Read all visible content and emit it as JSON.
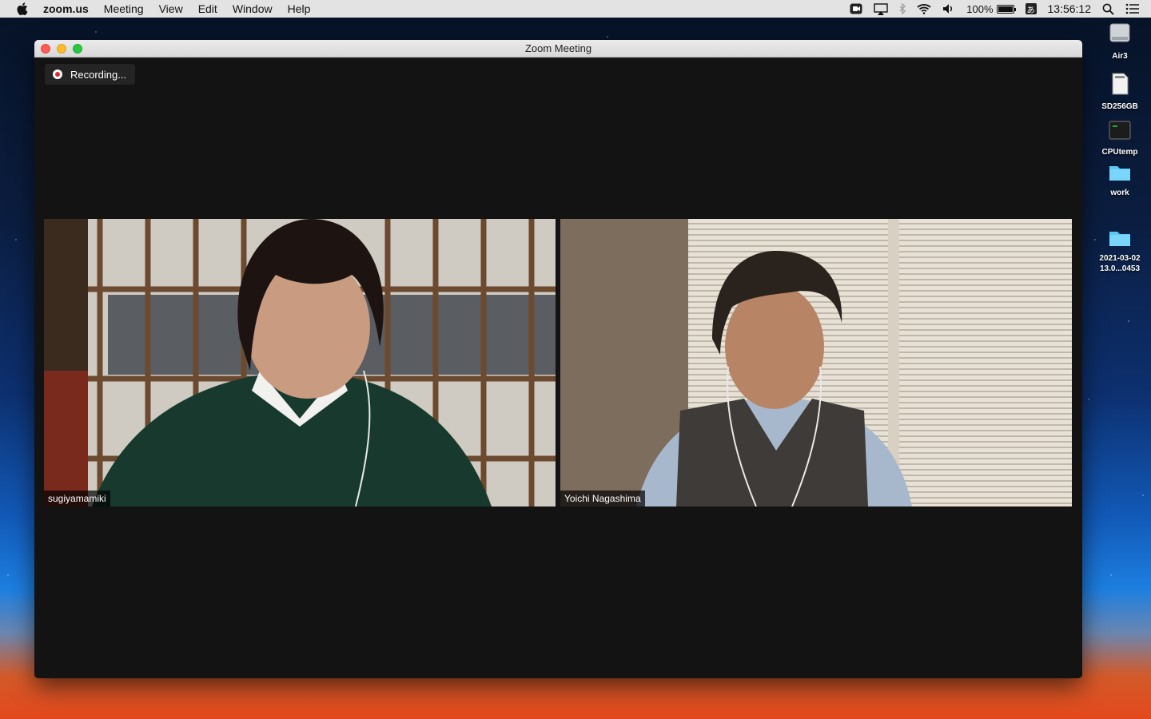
{
  "menubar": {
    "app_name": "zoom.us",
    "items": [
      "Meeting",
      "View",
      "Edit",
      "Window",
      "Help"
    ],
    "battery": "100%",
    "time": "13:56:12",
    "ime": "あ"
  },
  "desktop": {
    "icons": [
      {
        "label": "Air3",
        "icon": "hard-drive-icon"
      },
      {
        "label": "SD256GB",
        "icon": "sd-card-icon"
      },
      {
        "label": "CPUtemp",
        "icon": "terminal-icon"
      },
      {
        "label": "work",
        "icon": "folder-icon"
      },
      {
        "label_line1": "2021-03-02",
        "label_line2": "13.0...0453",
        "icon": "folder-icon"
      }
    ]
  },
  "window": {
    "title": "Zoom Meeting",
    "recording_label": "Recording...",
    "participants": [
      {
        "name": "sugiyamamiki"
      },
      {
        "name": "Yoichi Nagashima"
      }
    ]
  },
  "colors": {
    "window_bg": "#131313",
    "recording_dot": "#e02828",
    "folder": "#5ec8f5"
  }
}
